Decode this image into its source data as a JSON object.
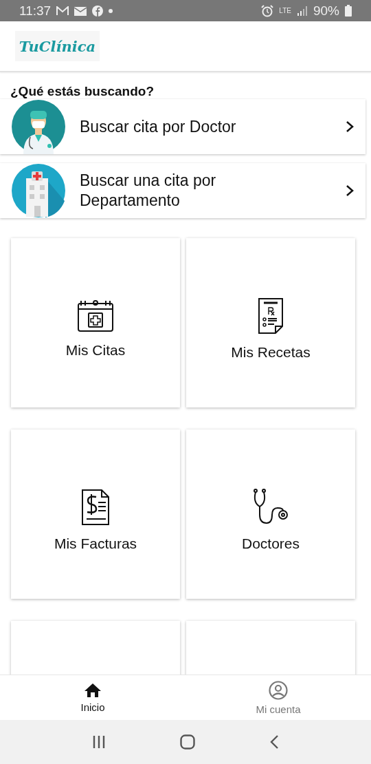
{
  "status_bar": {
    "time": "11:37",
    "network": "LTE",
    "battery": "90%"
  },
  "header": {
    "logo": "TuClínica"
  },
  "heading": "¿Qué estás buscando?",
  "search_options": [
    {
      "kind": "doctor",
      "label": "Buscar cita por Doctor"
    },
    {
      "kind": "department",
      "label": "Buscar una cita por Departamento"
    }
  ],
  "tiles": [
    {
      "kind": "calendar",
      "label": "Mis Citas"
    },
    {
      "kind": "prescription",
      "label": "Mis Recetas"
    },
    {
      "kind": "invoice",
      "label": "Mis Facturas"
    },
    {
      "kind": "stethoscope",
      "label": "Doctores"
    },
    {
      "kind": "cut"
    },
    {
      "kind": "cut"
    }
  ],
  "bottom_nav": [
    {
      "kind": "home",
      "label": "Inicio",
      "selected": true
    },
    {
      "kind": "account",
      "label": "Mi cuenta",
      "selected": false
    }
  ]
}
